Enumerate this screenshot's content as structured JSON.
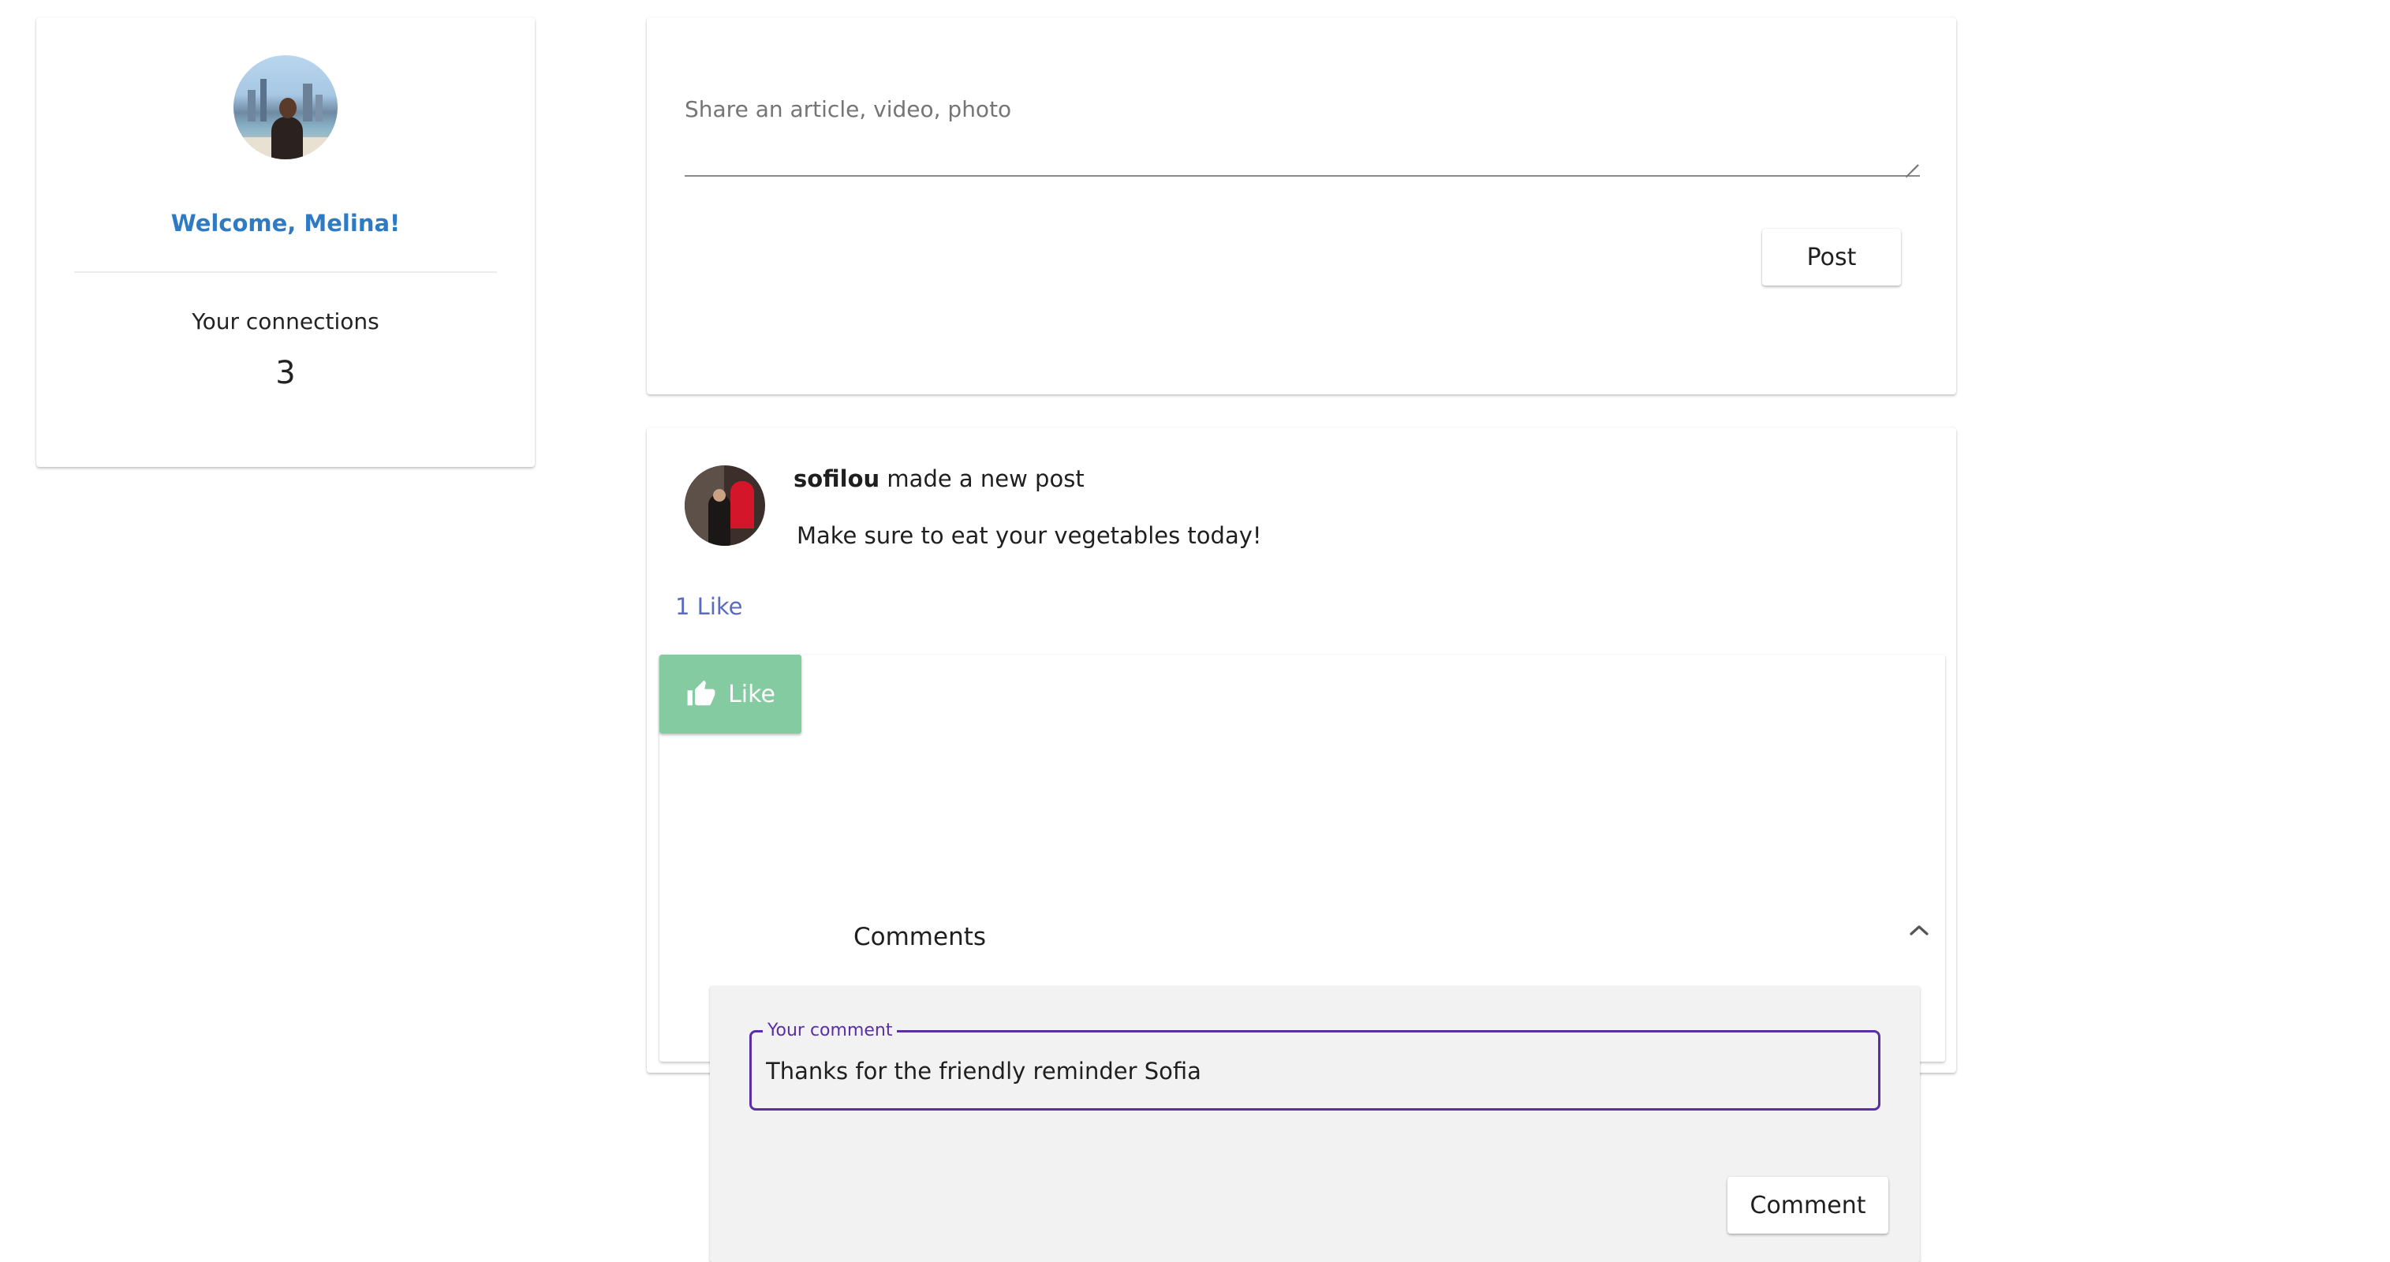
{
  "profile": {
    "welcome": "Welcome, Melina!",
    "connections_label": "Your connections",
    "connections_count": "3",
    "avatar_icon": "user-avatar-photo"
  },
  "composer": {
    "placeholder": "Share an article, video, photo",
    "post_label": "Post"
  },
  "post": {
    "author": "sofilou",
    "action": "made a new post",
    "body": "Make sure to eat your vegetables today!",
    "likes": "1 Like",
    "like_button_label": "Like",
    "like_icon": "thumbs-up-icon",
    "comments_title": "Comments",
    "collapse_icon": "chevron-up-icon",
    "comment_field_label": "Your comment",
    "comment_value": "Thanks for the friendly reminder Sofia",
    "comment_button_label": "Comment"
  },
  "colors": {
    "welcome_text": "#2e7bc4",
    "like_button_bg": "#84cba1",
    "like_count_text": "#5b6bbf",
    "focus_outline": "#5a2fa6"
  }
}
